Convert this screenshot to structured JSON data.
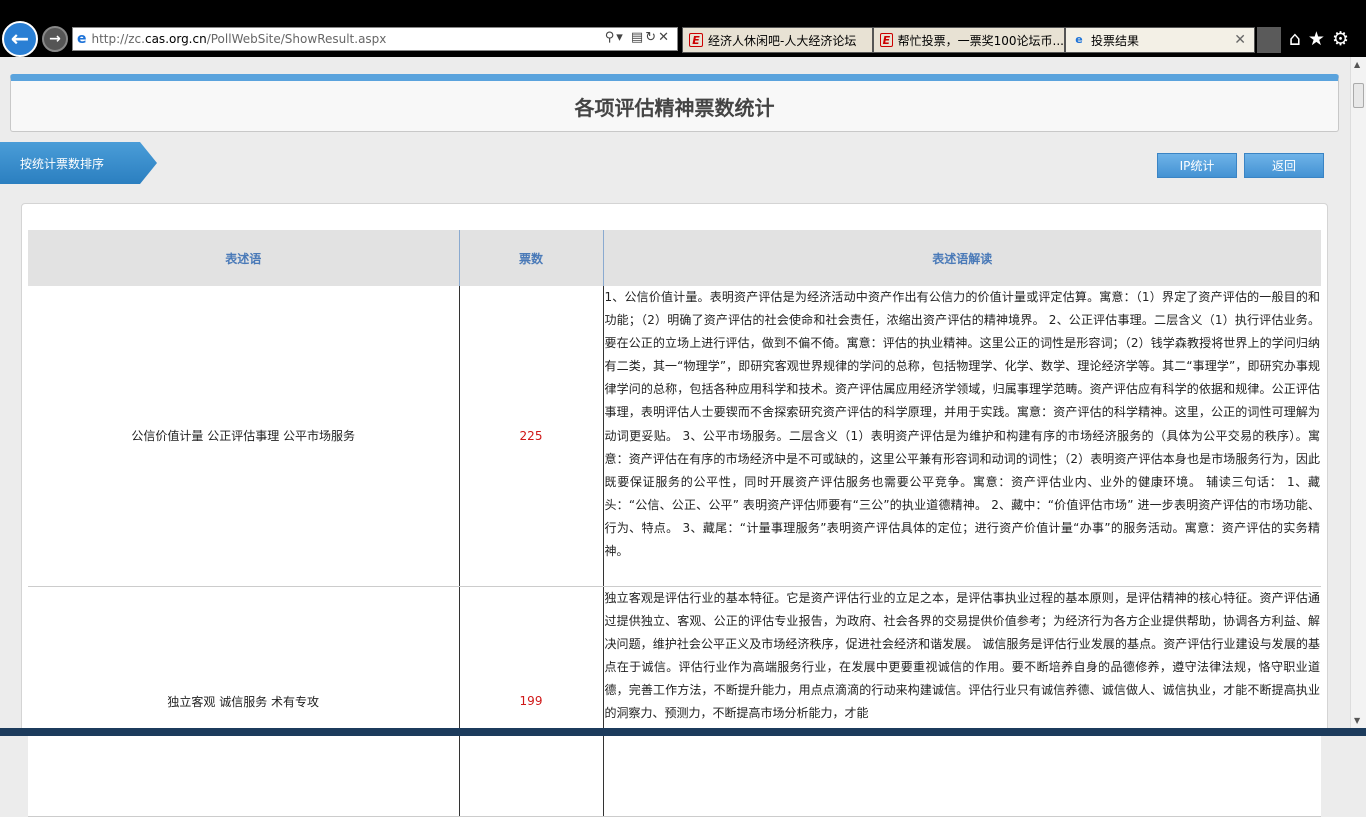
{
  "browser": {
    "url_prefix": "http://zc.",
    "url_host": "cas.org.cn",
    "url_path": "/PollWebSite/ShowResult.aspx",
    "tabs": [
      {
        "label": "经济人休闲吧-人大经济论坛",
        "icon": "red-e-icon"
      },
      {
        "label": "帮忙投票，一票奖100论坛币...",
        "icon": "red-e-icon"
      },
      {
        "label": "投票结果",
        "icon": "ie-icon",
        "active": true
      }
    ]
  },
  "page": {
    "title": "各项评估精神票数统计",
    "ribbon_label": "按统计票数排序",
    "ip_button": "IP统计",
    "back_button": "返回"
  },
  "table": {
    "headers": [
      "表述语",
      "票数",
      "表述语解读"
    ],
    "rows": [
      {
        "phrase": "公信价值计量 公正评估事理 公平市场服务",
        "votes": "225",
        "interpretation": "1、公信价值计量。表明资产评估是为经济活动中资产作出有公信力的价值计量或评定估算。寓意：（1）界定了资产评估的一般目的和功能；（2）明确了资产评估的社会使命和社会责任，浓缩出资产评估的精神境界。 2、公正评估事理。二层含义（1）执行评估业务。要在公正的立场上进行评估，做到不偏不倚。寓意：评估的执业精神。这里公正的词性是形容词；（2）钱学森教授将世界上的学问归纳有二类，其一“物理学”，即研究客观世界规律的学问的总称，包括物理学、化学、数学、理论经济学等。其二“事理学”，即研究办事规律学问的总称，包括各种应用科学和技术。资产评估属应用经济学领域，归属事理学范畴。资产评估应有科学的依据和规律。公正评估事理，表明评估人士要锲而不舍探索研究资产评估的科学原理，并用于实践。寓意：资产评估的科学精神。这里，公正的词性可理解为动词更妥贴。 3、公平市场服务。二层含义（1）表明资产评估是为维护和构建有序的市场经济服务的（具体为公平交易的秩序）。寓意：资产评估在有序的市场经济中是不可或缺的，这里公平兼有形容词和动词的词性；（2）表明资产评估本身也是市场服务行为，因此既要保证服务的公平性，同时开展资产评估服务也需要公平竞争。寓意：资产评估业内、业外的健康环境。 辅读三句话： 1、藏头：“公信、公正、公平” 表明资产评估师要有“三公”的执业道德精神。 2、藏中：“价值评估市场” 进一步表明资产评估的市场功能、行为、特点。 3、藏尾：“计量事理服务”表明资产评估具体的定位；进行资产价值计量“办事”的服务活动。寓意：资产评估的实务精神。"
      },
      {
        "phrase": "独立客观 诚信服务 术有专攻",
        "votes": "199",
        "interpretation": "独立客观是评估行业的基本特征。它是资产评估行业的立足之本，是评估事执业过程的基本原则，是评估精神的核心特征。资产评估通过提供独立、客观、公正的评估专业报告，为政府、社会各界的交易提供价值参考；为经济行为各方企业提供帮助，协调各方利益、解决问题，维护社会公平正义及市场经济秩序，促进社会经济和谐发展。 诚信服务是评估行业发展的基点。资产评估行业建设与发展的基点在于诚信。评估行业作为高端服务行业，在发展中更要重视诚信的作用。要不断培养自身的品德修养，遵守法律法规，恪守职业道德，完善工作方法，不断提升能力，用点点滴滴的行动来构建诚信。评估行业只有诚信养德、诚信做人、诚信执业，才能不断提高执业的洞察力、预测力，不断提高市场分析能力，才能"
      }
    ]
  }
}
